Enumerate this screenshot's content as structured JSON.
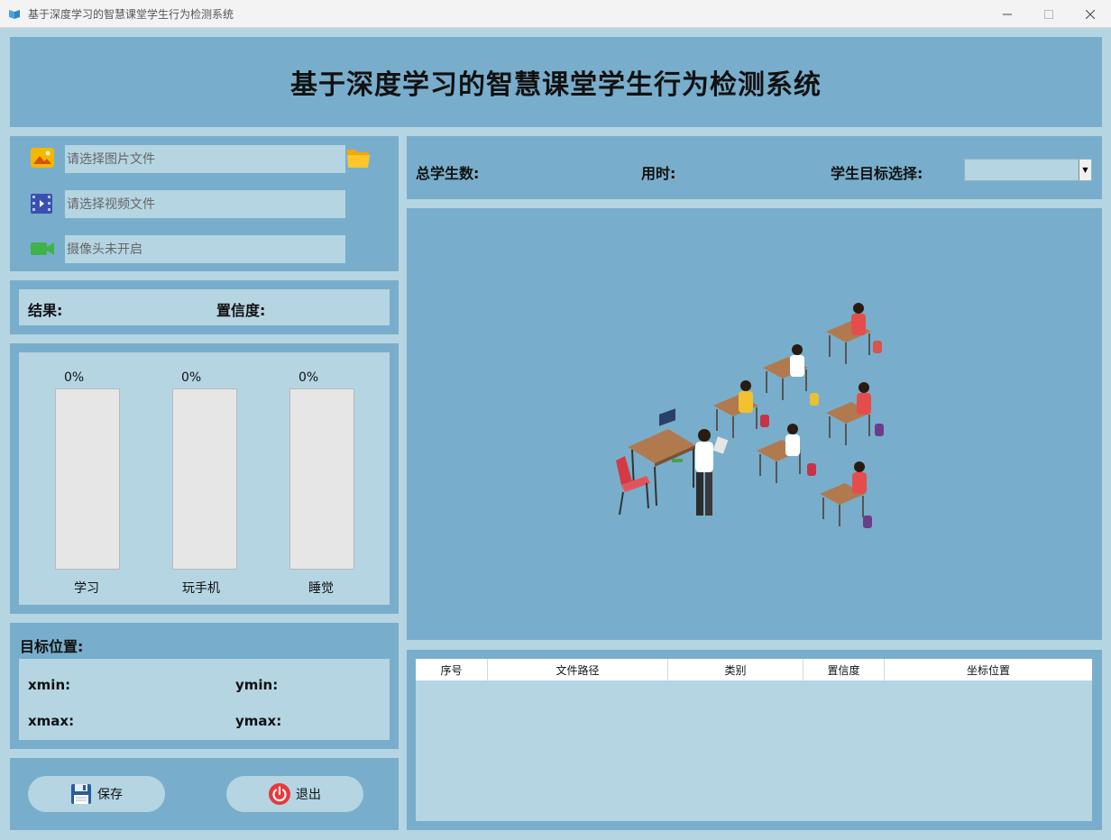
{
  "window": {
    "title": "基于深度学习的智慧课堂学生行为检测系统"
  },
  "header": {
    "title": "基于深度学习的智慧课堂学生行为检测系统"
  },
  "inputs": {
    "image_placeholder": "请选择图片文件",
    "video_placeholder": "请选择视频文件",
    "camera_placeholder": "摄像头未开启"
  },
  "result": {
    "result_label": "结果:",
    "confidence_label": "置信度:"
  },
  "bars": [
    {
      "label": "学习",
      "value": 0,
      "pct": "0%"
    },
    {
      "label": "玩手机",
      "value": 0,
      "pct": "0%"
    },
    {
      "label": "睡觉",
      "value": 0,
      "pct": "0%"
    }
  ],
  "position": {
    "title": "目标位置:",
    "xmin": "xmin:",
    "ymin": "ymin:",
    "xmax": "xmax:",
    "ymax": "ymax:"
  },
  "actions": {
    "save": "保存",
    "exit": "退出"
  },
  "stats": {
    "total_students": "总学生数:",
    "time_used": "用时:",
    "target_select": "学生目标选择:",
    "target_value": ""
  },
  "table": {
    "columns": [
      "序号",
      "文件路径",
      "类别",
      "置信度",
      "坐标位置"
    ]
  },
  "colors": {
    "panel": "#78aecb",
    "inner": "#b5d5e3"
  }
}
